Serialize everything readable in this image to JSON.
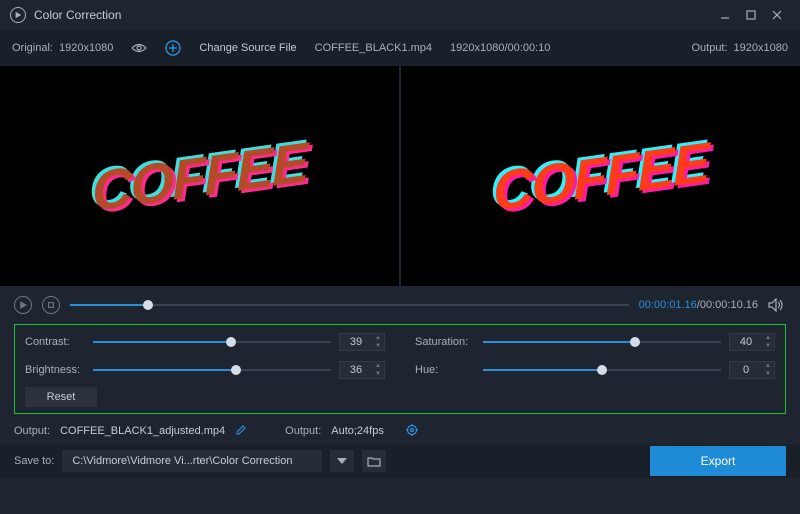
{
  "window": {
    "title": "Color Correction"
  },
  "topbar": {
    "original_label": "Original:",
    "original_res": "1920x1080",
    "change_source": "Change Source File",
    "filename": "COFFEE_BLACK1.mp4",
    "file_res_time": "1920x1080/00:00:10",
    "output_label": "Output:",
    "output_res": "1920x1080"
  },
  "preview": {
    "text": "COFFEE"
  },
  "transport": {
    "current": "00:00:01.16",
    "total": "00:00:10.16",
    "progress_pct": 14
  },
  "controls": {
    "contrast": {
      "label": "Contrast:",
      "value": 39,
      "pct": 58
    },
    "brightness": {
      "label": "Brightness:",
      "value": 36,
      "pct": 60
    },
    "saturation": {
      "label": "Saturation:",
      "value": 40,
      "pct": 64
    },
    "hue": {
      "label": "Hue:",
      "value": 0,
      "pct": 50
    },
    "reset": "Reset"
  },
  "output": {
    "label1": "Output:",
    "filename": "COFFEE_BLACK1_adjusted.mp4",
    "label2": "Output:",
    "format": "Auto;24fps"
  },
  "save": {
    "label": "Save to:",
    "path": "C:\\Vidmore\\Vidmore Vi...rter\\Color Correction",
    "export": "Export"
  }
}
